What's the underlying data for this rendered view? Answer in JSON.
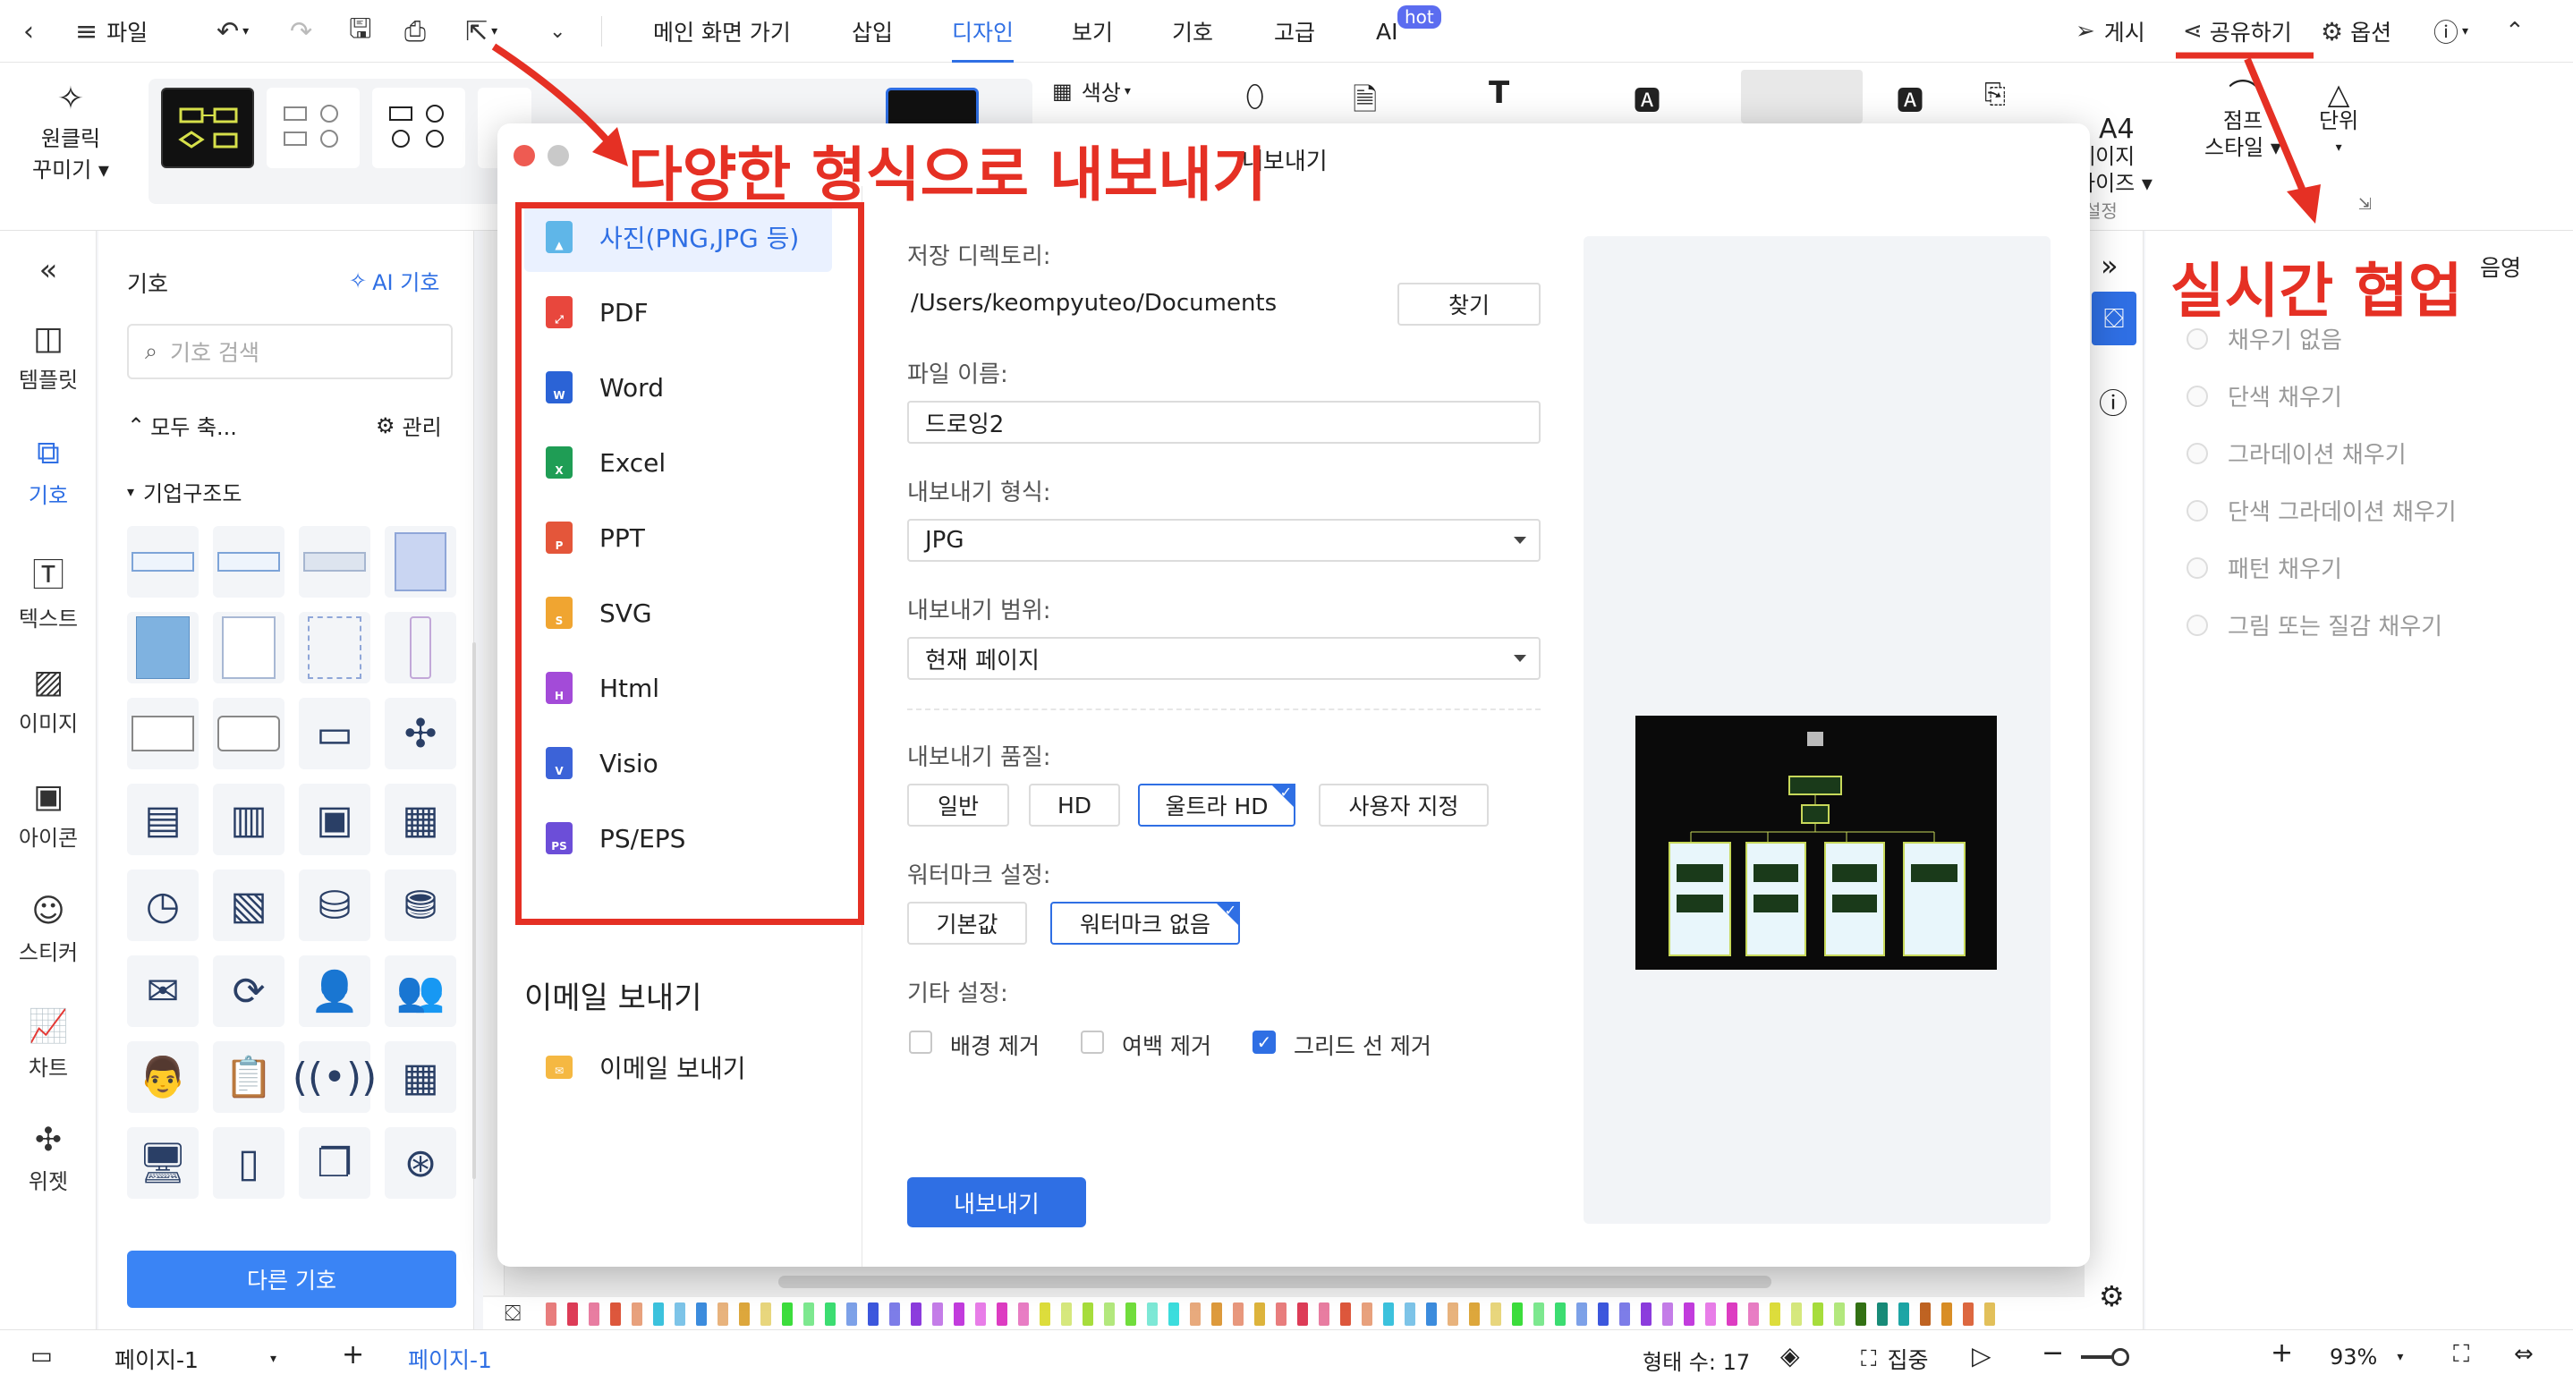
{
  "topbar": {
    "file_label": "파일",
    "menu_tabs": [
      "메인 화면 가기",
      "삽입",
      "디자인",
      "보기",
      "기호",
      "고급",
      "AI"
    ],
    "active_tab": "디자인",
    "ai_badge": "hot",
    "publish_label": "게시",
    "share_label": "공유하기",
    "options_label": "옵션"
  },
  "ribbon": {
    "oneclick_label_1": "원클릭",
    "oneclick_label_2": "꾸미기",
    "color_label": "색상",
    "page_size_label_1": "페이지",
    "page_size_label_2": "사이즈",
    "jump_style_label_1": "점프",
    "jump_style_label_2": "스타일",
    "unit_label": "단위",
    "settings_label": "설정"
  },
  "left_nav": {
    "items": [
      {
        "label": "템플릿",
        "icon": "template-icon"
      },
      {
        "label": "기호",
        "icon": "symbol-icon"
      },
      {
        "label": "텍스트",
        "icon": "text-icon"
      },
      {
        "label": "이미지",
        "icon": "image-icon"
      },
      {
        "label": "아이콘",
        "icon": "icon-icon"
      },
      {
        "label": "스티커",
        "icon": "sticker-icon"
      },
      {
        "label": "차트",
        "icon": "chart-icon"
      },
      {
        "label": "위젯",
        "icon": "widget-icon"
      }
    ],
    "active": "기호"
  },
  "symbol_panel": {
    "title": "기호",
    "ai_symbol": "AI 기호",
    "search_placeholder": "기호 검색",
    "collapse_all": "모두 축...",
    "manage": "관리",
    "category": "기업구조도",
    "more_symbols": "다른 기호"
  },
  "dialog": {
    "title": "내보내기",
    "formats": [
      "사진(PNG,JPG 등)",
      "PDF",
      "Word",
      "Excel",
      "PPT",
      "SVG",
      "Html",
      "Visio",
      "PS/EPS"
    ],
    "selected_format": "사진(PNG,JPG 등)",
    "email_section": "이메일 보내기",
    "email_item": "이메일 보내기",
    "save_dir_label": "저장 디렉토리:",
    "save_dir_value": "/Users/keompyuteo/Documents",
    "browse_button": "찾기",
    "file_name_label": "파일 이름:",
    "file_name_value": "드로잉2",
    "export_format_label": "내보내기 형식:",
    "export_format_value": "JPG",
    "export_range_label": "내보내기 범위:",
    "export_range_value": "현재 페이지",
    "quality_label": "내보내기 품질:",
    "quality_options": [
      "일반",
      "HD",
      "울트라 HD",
      "사용자 지정"
    ],
    "quality_selected": "울트라 HD",
    "watermark_label": "워터마크 설정:",
    "watermark_options": [
      "기본값",
      "워터마크 없음"
    ],
    "watermark_selected": "워터마크 없음",
    "other_label": "기타 설정:",
    "other_options": [
      {
        "label": "배경 제거",
        "checked": false
      },
      {
        "label": "여백 제거",
        "checked": false
      },
      {
        "label": "그리드 선 제거",
        "checked": true
      }
    ],
    "export_button": "내보내기"
  },
  "annotations": {
    "export_formats": "다양한 형식으로 내보내기",
    "realtime_collab": "실시간 협업"
  },
  "right_panel": {
    "shadow_tab": "음영",
    "fill_options": [
      "채우기 없음",
      "단색 채우기",
      "그라데이션 채우기",
      "단색 그라데이션 채우기",
      "패턴 채우기",
      "그림 또는 질감 채우기"
    ]
  },
  "status": {
    "page_dropdown": "페이지-1",
    "page_tab": "페이지-1",
    "shape_count": "형태 수: 17",
    "focus": "집중",
    "zoom": "93%"
  },
  "colors": {
    "accent": "#2f6fe4",
    "annotation_red": "#e53024"
  }
}
